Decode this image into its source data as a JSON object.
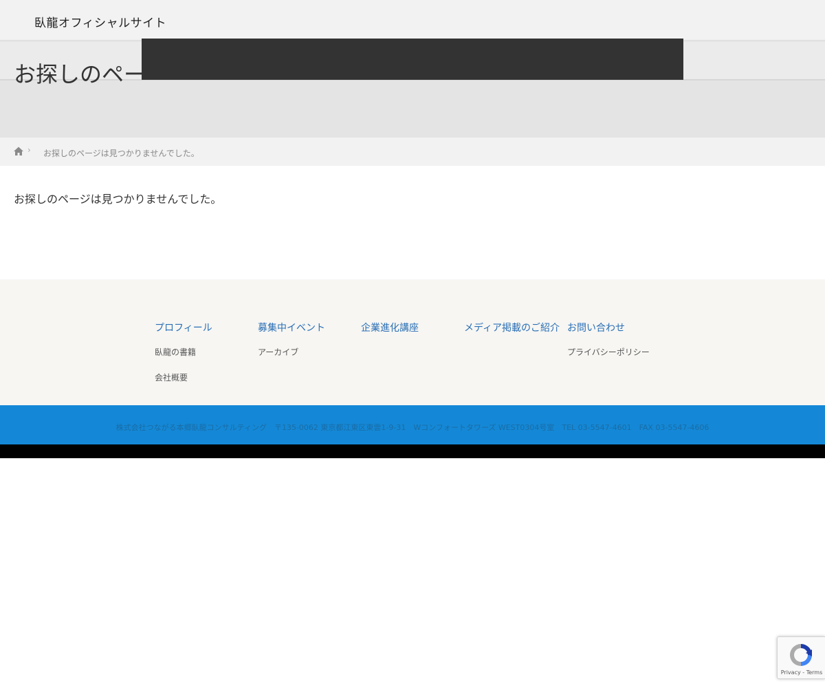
{
  "header": {
    "site_title": "臥龍オフィシャルサイト"
  },
  "page": {
    "heading": "お探しのペー"
  },
  "breadcrumb": {
    "separator": "›",
    "current": "お探しのページは見つかりませんでした。"
  },
  "main": {
    "message": "お探しのページは見つかりませんでした。"
  },
  "footer_nav": {
    "columns": [
      {
        "heading": "プロフィール",
        "links": [
          "臥龍の書籍",
          "会社概要"
        ]
      },
      {
        "heading": "募集中イベント",
        "links": [
          "アーカイブ"
        ]
      },
      {
        "heading": "企業進化講座",
        "links": []
      },
      {
        "heading": "メディア掲載のご紹介",
        "links": []
      },
      {
        "heading": "お問い合わせ",
        "links": [
          "プライバシーポリシー"
        ]
      }
    ]
  },
  "address": {
    "text": "株式会社つながる本郷臥龍コンサルティング　〒135-0062 東京都江東区東雲1-9-31　Wコンフォートタワーズ WEST0304号室　TEL 03-5547-4601　FAX 03-5547-4606"
  },
  "recaptcha": {
    "privacy": "Privacy",
    "separator": " - ",
    "terms": "Terms"
  },
  "colors": {
    "footer_heading": "#2a6fb5",
    "address_bar": "#1488d6",
    "overlay": "#333333"
  }
}
